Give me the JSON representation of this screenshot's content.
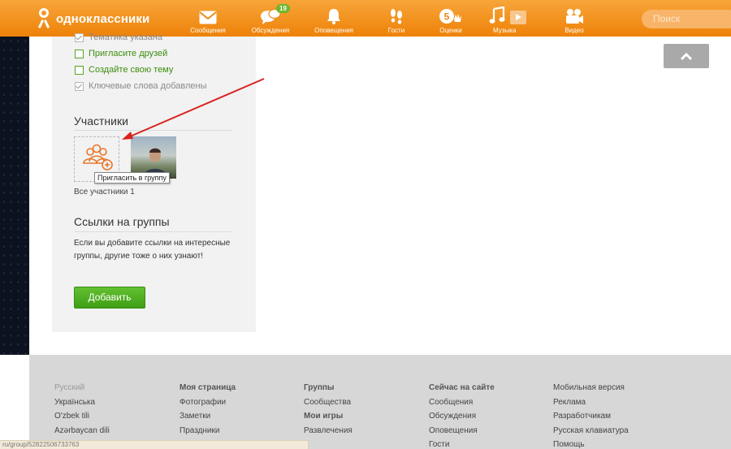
{
  "brand": {
    "name": "одноклассники"
  },
  "nav": [
    {
      "label": "Сообщения",
      "icon": "envelope-icon"
    },
    {
      "label": "Обсуждения",
      "icon": "chat-bubbles-icon",
      "badge": "19"
    },
    {
      "label": "Оповещения",
      "icon": "bell-icon"
    },
    {
      "label": "Гости",
      "icon": "footprints-icon"
    },
    {
      "label": "Оценки",
      "icon": "rating-five-icon"
    },
    {
      "label": "Музыка",
      "icon": "music-note-icon"
    },
    {
      "label": "Видео",
      "icon": "video-camera-icon"
    }
  ],
  "search": {
    "placeholder": "Поиск"
  },
  "checklist": [
    {
      "label": "Тематика указана",
      "done": true
    },
    {
      "label": "Пригласите друзей",
      "done": false
    },
    {
      "label": "Создайте свою тему",
      "done": false
    },
    {
      "label": "Ключевые слова добавлены",
      "done": true
    }
  ],
  "members": {
    "title": "Участники",
    "tooltip": "Пригласить в группу",
    "all_label": "Все участники 1"
  },
  "links": {
    "title": "Ссылки на группы",
    "text": "Если вы добавите ссылки на интересные группы, другие тоже о них узнают!",
    "button": "Добавить"
  },
  "footer": {
    "languages": [
      "Русский",
      "Українська",
      "O'zbek tili",
      "Azərbaycan dili"
    ],
    "my_page": {
      "title": "Моя страница",
      "items": [
        "Фотографии",
        "Заметки",
        "Праздники"
      ]
    },
    "groups": {
      "title": "Группы",
      "items": [
        "Сообщества"
      ],
      "games_title": "Мои игры",
      "games_items": [
        "Развлечения"
      ]
    },
    "now_on_site": {
      "title": "Сейчас на сайте",
      "items": [
        "Сообщения",
        "Обсуждения",
        "Оповещения",
        "Гости"
      ]
    },
    "misc": {
      "items": [
        "Мобильная версия",
        "Реклама",
        "Разработчикам",
        "Русская клавиатура",
        "Помощь"
      ]
    }
  },
  "status_url": "ru/group/52822506733763",
  "colors": {
    "brand_orange": "#ee8208",
    "accent_green": "#4aa71c",
    "arrow_red": "#d9231d"
  }
}
